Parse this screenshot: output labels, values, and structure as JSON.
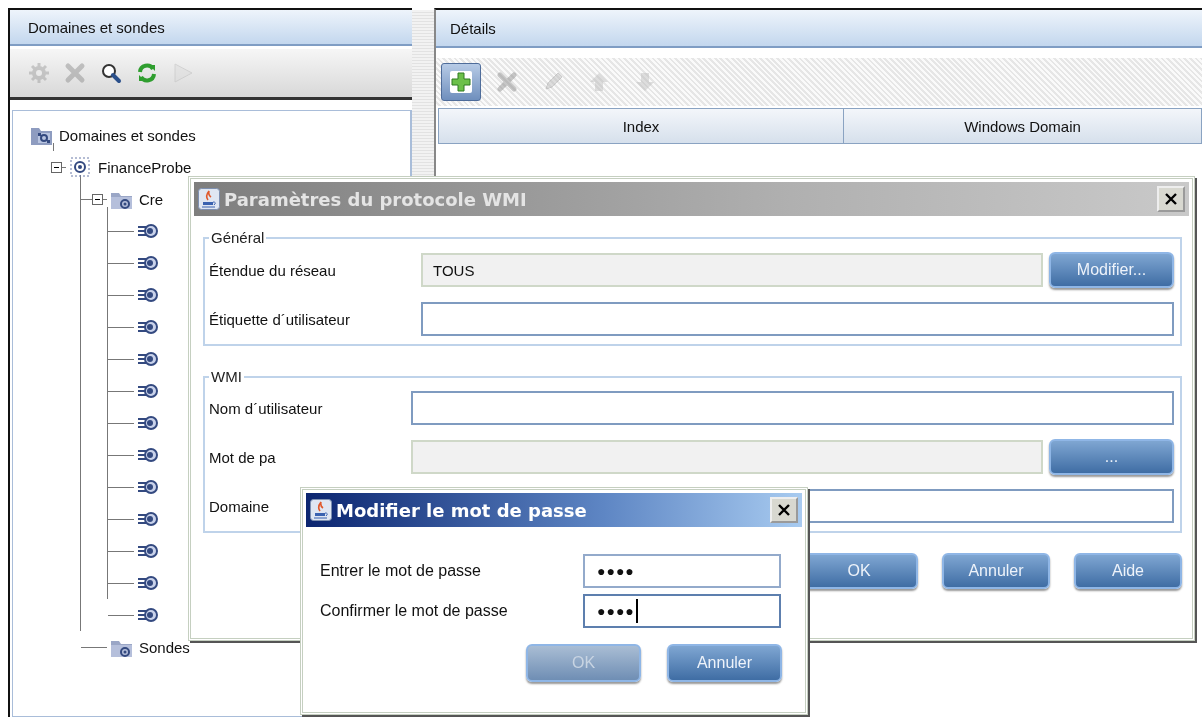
{
  "left_panel": {
    "title": "Domaines et sondes",
    "toolbar": [
      {
        "kind": "gear",
        "disabled": true
      },
      {
        "kind": "delete",
        "disabled": true
      },
      {
        "kind": "search",
        "disabled": false
      },
      {
        "kind": "refresh",
        "disabled": false
      },
      {
        "kind": "run",
        "disabled": true
      }
    ],
    "tree": [
      {
        "label": "Domaines et sondes",
        "kind": "domains",
        "children": [
          {
            "label": "FinanceProbe",
            "kind": "probe-domain",
            "expanded": true,
            "children": [
              {
                "label": "Cre",
                "kind": "folder",
                "expanded": true,
                "children": [
                  {
                    "kind": "probe"
                  },
                  {
                    "kind": "probe"
                  },
                  {
                    "kind": "probe"
                  },
                  {
                    "kind": "probe"
                  },
                  {
                    "kind": "probe"
                  },
                  {
                    "kind": "probe"
                  },
                  {
                    "kind": "probe"
                  },
                  {
                    "kind": "probe"
                  },
                  {
                    "kind": "probe"
                  },
                  {
                    "kind": "probe"
                  },
                  {
                    "kind": "probe"
                  },
                  {
                    "kind": "probe"
                  },
                  {
                    "kind": "probe"
                  }
                ]
              },
              {
                "label": "Sondes",
                "kind": "folder"
              }
            ]
          }
        ]
      }
    ]
  },
  "details_panel": {
    "title": "Détails",
    "toolbar": [
      {
        "kind": "add",
        "disabled": false,
        "highlighted": true
      },
      {
        "kind": "delete",
        "disabled": true,
        "highlighted": false
      },
      {
        "kind": "edit",
        "disabled": true,
        "highlighted": false
      },
      {
        "kind": "up",
        "disabled": true,
        "highlighted": false
      },
      {
        "kind": "down",
        "disabled": true,
        "highlighted": false
      }
    ],
    "table": {
      "columns": [
        "Index",
        "Windows Domain"
      ]
    }
  },
  "wmi_dialog": {
    "title": "Paramètres du protocole WMI",
    "active": false,
    "groups": [
      {
        "title": "Général",
        "rows": [
          {
            "label": "Étendue du réseau",
            "value": "TOUS",
            "disabled": true,
            "button": "Modifier..."
          },
          {
            "label": "Étiquette d´utilisateur",
            "disabled": false
          }
        ]
      },
      {
        "title": "WMI",
        "rows": [
          {
            "label": "Nom d´utilisateur",
            "disabled": false
          },
          {
            "label": "Mot de pa",
            "disabled": true,
            "button": "..."
          },
          {
            "label": "Domaine",
            "disabled": false
          }
        ]
      }
    ],
    "buttons": [
      {
        "label": "OK",
        "disabled": false
      },
      {
        "label": "Annuler",
        "disabled": false
      },
      {
        "label": "Aide",
        "disabled": false
      }
    ]
  },
  "password_dialog": {
    "title": "Modifier le mot de passe",
    "active": true,
    "fields": [
      {
        "label": "Entrer le mot de passe",
        "value": "●●●●",
        "focused": false
      },
      {
        "label": "Confirmer le mot de passe",
        "value": "●●●●",
        "focused": true
      }
    ],
    "buttons": [
      {
        "label": "OK",
        "disabled": true
      },
      {
        "label": "Annuler",
        "disabled": false
      }
    ]
  }
}
